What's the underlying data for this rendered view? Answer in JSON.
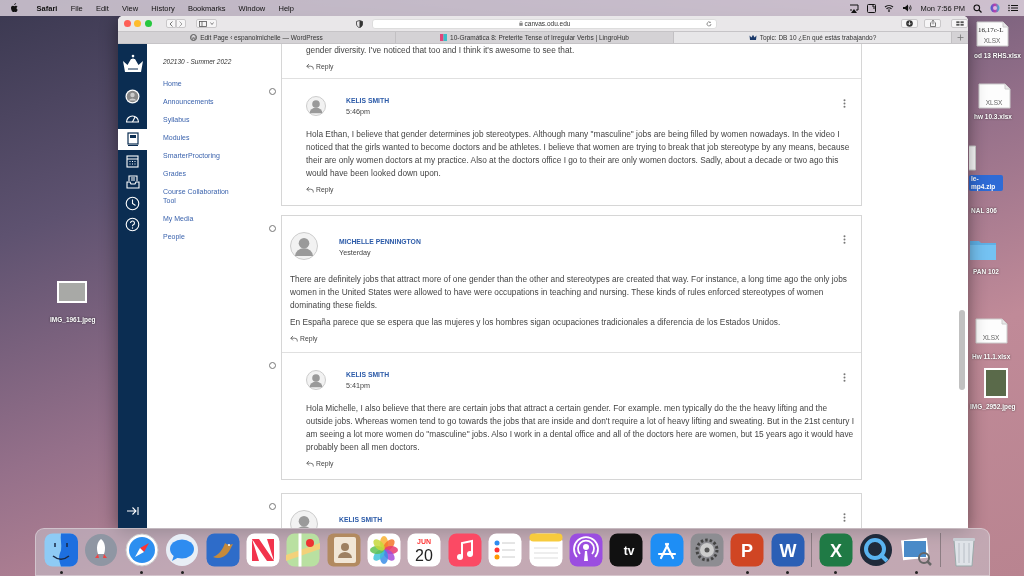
{
  "menu_bar": {
    "app": "Safari",
    "menus": [
      "File",
      "Edit",
      "View",
      "History",
      "Bookmarks",
      "Window",
      "Help"
    ],
    "clock": "Mon 7:56 PM"
  },
  "desktop_icons": [
    {
      "kind": "sheet",
      "thumb_text": "16,17c-L",
      "badge": "XLSX",
      "label": "od 13 RHS.xlsx",
      "selected": false
    },
    {
      "kind": "sheet",
      "badge": "XLSX",
      "label": "hw 10.3.xlsx",
      "selected": false
    },
    {
      "kind": "document",
      "label": "le-mp4.zip",
      "selected": true
    },
    {
      "kind": "hidden",
      "label": "NAL 306",
      "selected": false
    },
    {
      "kind": "folder",
      "label": "PAN 102",
      "selected": false
    },
    {
      "kind": "sheet",
      "badge": "XLSX",
      "label": "Hw 11.1.xlsx",
      "selected": false
    },
    {
      "kind": "photo",
      "label": "IMG_2952.jpeg",
      "selected": false
    },
    {
      "kind": "photo",
      "label": "IMG_1961.jpeg",
      "selected": false
    }
  ],
  "safari": {
    "address": "canvas.odu.edu",
    "tabs": [
      {
        "title": "Edit Page ‹ espanolmichelle — WordPress",
        "kind": "wordpress",
        "selected": false
      },
      {
        "title": "10-Gramática 8: Preterite Tense of Irregular Verbs | LingroHub",
        "kind": "lingro",
        "selected": false
      },
      {
        "title": "Topic: DB 10 ¿En qué estás trabajando?",
        "kind": "canvas",
        "selected": true
      }
    ]
  },
  "canvas": {
    "global_nav": [
      {
        "kind": "account",
        "selected": false
      },
      {
        "kind": "dashboard",
        "selected": false
      },
      {
        "kind": "courses",
        "selected": true
      },
      {
        "kind": "calendar",
        "selected": false
      },
      {
        "kind": "inbox",
        "selected": false
      },
      {
        "kind": "history",
        "selected": false
      },
      {
        "kind": "help",
        "selected": false
      }
    ],
    "course_nav": {
      "term": "202130 - Summer 2022",
      "links": [
        "Home",
        "Announcements",
        "Syllabus",
        "Modules",
        "SmarterProctoring",
        "Grades",
        "Course Collaboration Tool",
        "My Media",
        "People"
      ]
    },
    "threads": [
      {
        "posts": [
          {
            "kind": "reply",
            "paragraphs": [
              "gender diversity. I've noticed that too and I think it's awesome to see that."
            ],
            "reply": "Reply"
          },
          {
            "kind": "reply",
            "author": "KELIS SMITH",
            "time": "5:46pm",
            "paragraphs": [
              "Hola Ethan, I believe that gender determines job stereotypes. Although many \"masculine\" jobs are being filled by women nowadays. In the video I noticed that the girls wanted to become doctors and be athletes. I believe that women are trying to break that job stereotype by any means, because their are only women doctors at my practice. Also at the doctors office I go to their are only women doctors. Sadly, about a decade or two ago this would have been looked down upon."
            ],
            "reply": "Reply"
          }
        ]
      },
      {
        "posts": [
          {
            "kind": "top",
            "author": "MICHELLE PENNINGTON",
            "time": "Yesterday",
            "paragraphs": [
              "There are definitely jobs that attract more of one gender than the other and stereotypes are created that way. For instance, a long time ago the only jobs women in the United States were allowed to have were occupations in teaching and nursing. These kinds of rules enforced stereotypes of women dominating these fields.",
              "En España parece que se espera que las mujeres y los hombres sigan ocupaciones tradicionales a diferencia de los Estados Unidos."
            ],
            "reply": "Reply"
          },
          {
            "kind": "reply",
            "author": "KELIS SMITH",
            "time": "5:41pm",
            "paragraphs": [
              "Hola Michelle, I also believe that there are certain jobs that attract a certain gender. For example. men typically do the the heavy lifting and the outside jobs. Whereas women tend to go towards the jobs that are inside and don't require a lot of heavy lifting and sweating. But in the 21st century I am seeing a lot more women do \"masculine\" jobs. Also I work in a dental office and all of the doctors here are women, but 15 years ago it would have probably been all men doctors."
            ],
            "reply": "Reply"
          }
        ]
      },
      {
        "posts": [
          {
            "kind": "top",
            "author": "KELIS SMITH"
          }
        ]
      }
    ]
  },
  "dock": [
    {
      "kind": "finder",
      "running": true
    },
    {
      "kind": "launchpad",
      "running": false
    },
    {
      "kind": "safari",
      "running": true
    },
    {
      "kind": "messages",
      "running": true
    },
    {
      "kind": "bird",
      "running": false
    },
    {
      "kind": "news",
      "running": false
    },
    {
      "kind": "maps",
      "running": false
    },
    {
      "kind": "contacts",
      "running": false
    },
    {
      "kind": "photos",
      "running": false
    },
    {
      "kind": "calendar",
      "month": "JUN",
      "day": "20",
      "running": false
    },
    {
      "kind": "music",
      "running": false
    },
    {
      "kind": "reminders",
      "running": false
    },
    {
      "kind": "notes",
      "running": false
    },
    {
      "kind": "podcasts",
      "running": false
    },
    {
      "kind": "tv",
      "label": "tv",
      "running": false
    },
    {
      "kind": "appstore",
      "running": false
    },
    {
      "kind": "settings",
      "running": false
    },
    {
      "kind": "powerpoint",
      "label": "P",
      "running": true
    },
    {
      "kind": "word",
      "label": "W",
      "running": true
    },
    {
      "kind": "divider"
    },
    {
      "kind": "excel",
      "label": "X",
      "running": true
    },
    {
      "kind": "quicktime",
      "running": false
    },
    {
      "kind": "preview",
      "running": true
    },
    {
      "kind": "divider"
    },
    {
      "kind": "trash",
      "running": false
    }
  ]
}
